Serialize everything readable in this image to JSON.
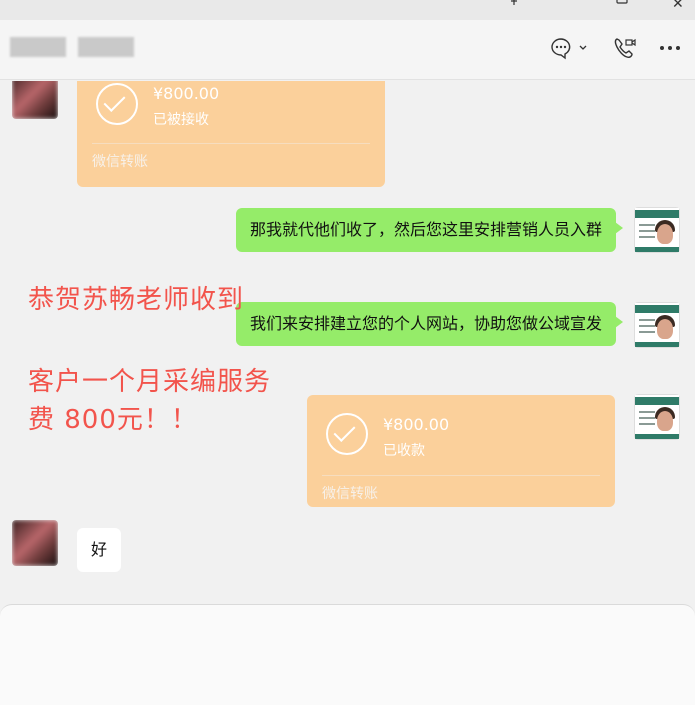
{
  "window": {
    "pin_icon": "pin-icon",
    "minimize_icon": "minimize-icon",
    "close_label": "✕"
  },
  "header": {
    "chat_name": "",
    "icons": [
      "chat-more-icon",
      "video-call-icon",
      "more-options-icon"
    ]
  },
  "messages": [
    {
      "type": "transfer",
      "side": "left",
      "amount": "¥800.00",
      "status": "已被接收",
      "footer": "微信转账"
    },
    {
      "type": "text",
      "side": "right",
      "text": "那我就代他们收了，然后您这里安排营销人员入群"
    },
    {
      "type": "text",
      "side": "right",
      "text": "我们来安排建立您的个人网站，协助您做公域宣发"
    },
    {
      "type": "transfer",
      "side": "right",
      "amount": "¥800.00",
      "status": "已收款",
      "footer": "微信转账"
    },
    {
      "type": "text",
      "side": "left",
      "text": "好"
    }
  ],
  "overlay": {
    "line1": "恭贺苏畅老师收到",
    "line2": "客户一个月采编服务",
    "line3": "费 800元！！"
  },
  "colors": {
    "green_bubble": "#95ec69",
    "transfer": "#fbd09b",
    "overlay_text": "#f2544c"
  }
}
